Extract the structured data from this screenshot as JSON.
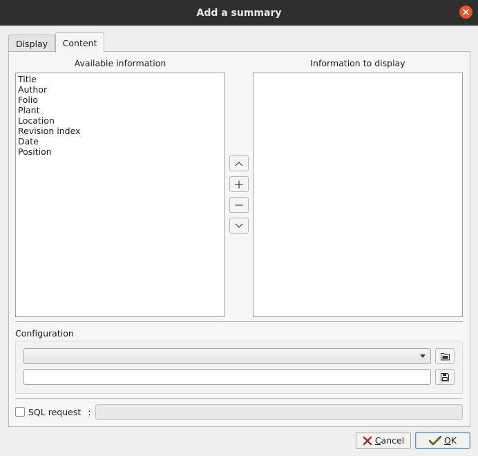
{
  "window": {
    "title": "Add a summary",
    "close_icon": "close-icon"
  },
  "tabs": [
    {
      "label": "Display",
      "active": false
    },
    {
      "label": "Content",
      "active": true
    }
  ],
  "available": {
    "heading": "Available information",
    "items": [
      "Title",
      "Author",
      "Folio",
      "Plant",
      "Location",
      "Revision index",
      "Date",
      "Position"
    ]
  },
  "display": {
    "heading": "Information to display",
    "items": []
  },
  "move_buttons": {
    "up": "chevron-up-icon",
    "add": "plus-icon",
    "remove": "minus-icon",
    "down": "chevron-down-icon"
  },
  "configuration": {
    "heading": "Configuration",
    "combo_value": "",
    "name_value": "",
    "open_icon": "folder-open-icon",
    "save_icon": "save-icon"
  },
  "sql": {
    "label": "SQL request",
    "colon": ":",
    "checked": false,
    "value": ""
  },
  "buttons": {
    "cancel_prefix": "C",
    "cancel_rest": "ancel",
    "ok_prefix": "O",
    "ok_rest": "K"
  },
  "colors": {
    "accent": "#e95420",
    "titlebar": "#2f2f2f",
    "focus": "#5b8fc5"
  }
}
